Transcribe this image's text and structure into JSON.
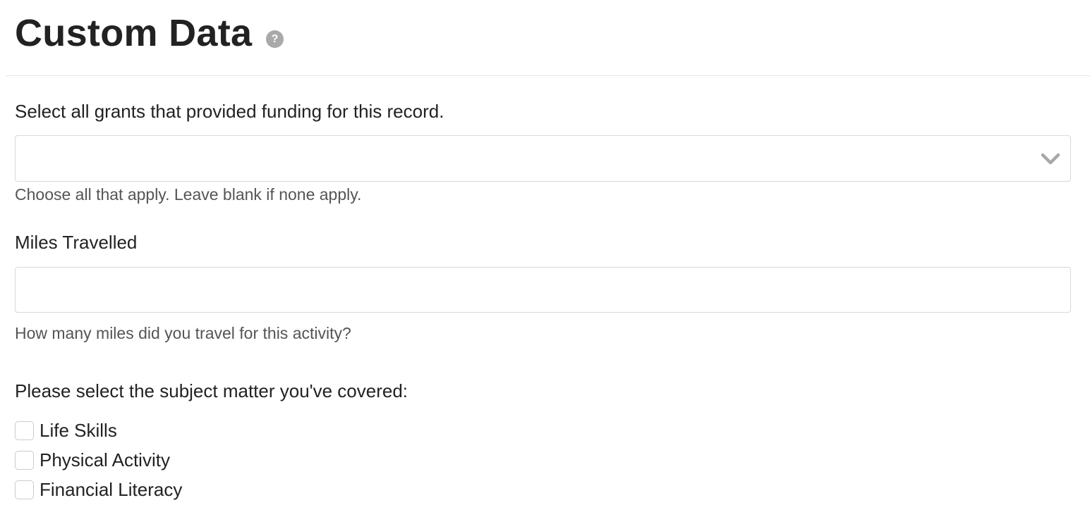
{
  "page": {
    "title": "Custom Data",
    "help_icon_glyph": "?"
  },
  "grants": {
    "label": "Select all grants that provided funding for this record.",
    "selected_value": "",
    "help": "Choose all that apply. Leave blank if none apply.",
    "icon": "chevron-down-icon"
  },
  "miles": {
    "label": "Miles Travelled",
    "value": "",
    "placeholder": "",
    "help": "How many miles did you travel for this activity?"
  },
  "subjects": {
    "label": "Please select the subject matter you've covered:",
    "options": [
      {
        "label": "Life Skills",
        "checked": false
      },
      {
        "label": "Physical Activity",
        "checked": false
      },
      {
        "label": "Financial Literacy",
        "checked": false
      }
    ]
  },
  "colors": {
    "text": "#222222",
    "muted": "#555555",
    "border": "#d9d9d9",
    "icon": "#a9a9a9"
  }
}
